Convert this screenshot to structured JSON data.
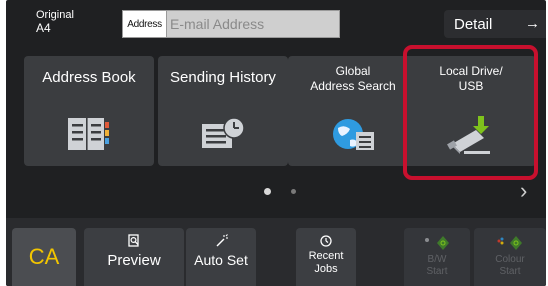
{
  "header": {
    "original_label": "Original",
    "original_value": "A4",
    "address_tag": "Address",
    "address_placeholder": "E-mail Address",
    "detail_label": "Detail",
    "detail_arrow": "→"
  },
  "tiles": [
    {
      "label": "Address Book",
      "icon": "address-book-icon"
    },
    {
      "label": "Sending History",
      "icon": "sending-history-icon"
    },
    {
      "label_line1": "Global",
      "label_line2": "Address Search",
      "icon": "global-address-search-icon"
    },
    {
      "label_line1": "Local Drive/",
      "label_line2": "USB",
      "icon": "usb-drive-icon"
    }
  ],
  "pagination": {
    "next": "›"
  },
  "bottom_bar": {
    "ca": "CA",
    "preview": "Preview",
    "auto_set": "Auto Set",
    "recent_line1": "Recent",
    "recent_line2": "Jobs",
    "bw_line1": "B/W",
    "bw_line2": "Start",
    "color_line1": "Colour",
    "color_line2": "Start"
  },
  "colors": {
    "panel_bg": "#1f2022",
    "tile_bg": "#3b3d40",
    "highlight": "#c8102e",
    "ca_text": "#f2c500",
    "usb_arrow": "#7fc31c",
    "doc_icon": "#cfd2d6"
  }
}
